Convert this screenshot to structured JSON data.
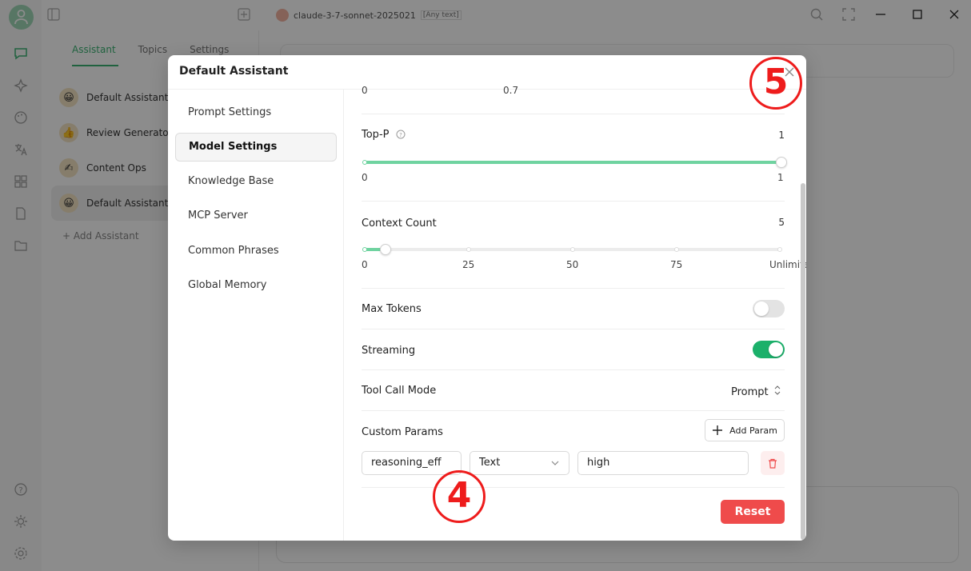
{
  "topbar": {
    "model_name": "claude-3-7-sonnet-2025021",
    "model_tag": "[Any text]"
  },
  "panel": {
    "tabs": [
      {
        "label": "Assistant"
      },
      {
        "label": "Topics"
      },
      {
        "label": "Settings"
      }
    ],
    "assistants": [
      {
        "label": "Default Assistant",
        "emoji": "😀"
      },
      {
        "label": "Review Generator",
        "emoji": "👍"
      },
      {
        "label": "Content Ops",
        "emoji": "✍"
      },
      {
        "label": "Default Assistant",
        "emoji": "😀"
      }
    ],
    "add_label": "+ Add Assistant"
  },
  "modal": {
    "title": "Default Assistant",
    "nav": [
      {
        "label": "Prompt Settings"
      },
      {
        "label": "Model Settings"
      },
      {
        "label": "Knowledge Base"
      },
      {
        "label": "MCP Server"
      },
      {
        "label": "Common Phrases"
      },
      {
        "label": "Global Memory"
      }
    ],
    "temperature": {
      "min_label": "0",
      "mark_label": "0.7"
    },
    "top_p": {
      "label": "Top-P",
      "value": "1",
      "min_label": "0",
      "max_label": "1",
      "level": 1.0
    },
    "context_count": {
      "label": "Context Count",
      "value": "5",
      "ticks": [
        "0",
        "25",
        "50",
        "75",
        "Unlimited"
      ],
      "level": 0.05
    },
    "max_tokens": {
      "label": "Max Tokens",
      "enabled": false
    },
    "streaming": {
      "label": "Streaming",
      "enabled": true
    },
    "tool_call_mode": {
      "label": "Tool Call Mode",
      "value": "Prompt"
    },
    "custom_params": {
      "label": "Custom Params",
      "add_label": "Add Param",
      "row": {
        "name": "reasoning_eff",
        "type": "Text",
        "value": "high"
      }
    },
    "reset_label": "Reset"
  },
  "annotations": {
    "badge_4": "4",
    "badge_5": "5"
  },
  "colors": {
    "accent": "#3bb273",
    "slider": "#6fd3a0",
    "toggle_on": "#1bb06a",
    "danger": "#ef4b4b",
    "badge": "#ee1c1c"
  }
}
